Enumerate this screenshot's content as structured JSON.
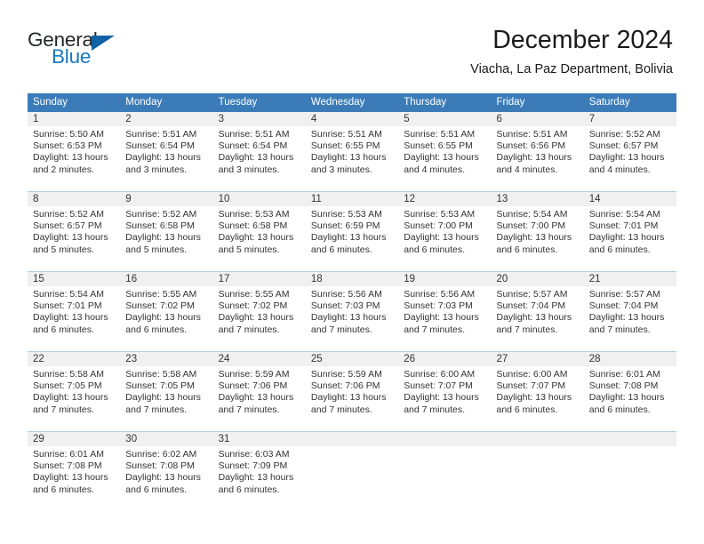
{
  "brand": {
    "name_top": "General",
    "name_bottom": "Blue",
    "accent_color": "#1878be",
    "triangle_color": "#1162a6",
    "logo_icon": "blue-triangle-icon"
  },
  "header": {
    "title": "December 2024",
    "subtitle": "Viacha, La Paz Department, Bolivia"
  },
  "calendar": {
    "header_bg": "#3b7cb8",
    "header_text_color": "#ffffff",
    "daynum_bg": "#f0f0f0",
    "weekday_headers": [
      "Sunday",
      "Monday",
      "Tuesday",
      "Wednesday",
      "Thursday",
      "Friday",
      "Saturday"
    ],
    "weeks": [
      [
        {
          "day": "1",
          "lines": [
            "Sunrise: 5:50 AM",
            "Sunset: 6:53 PM",
            "Daylight: 13 hours",
            "and 2 minutes."
          ]
        },
        {
          "day": "2",
          "lines": [
            "Sunrise: 5:51 AM",
            "Sunset: 6:54 PM",
            "Daylight: 13 hours",
            "and 3 minutes."
          ]
        },
        {
          "day": "3",
          "lines": [
            "Sunrise: 5:51 AM",
            "Sunset: 6:54 PM",
            "Daylight: 13 hours",
            "and 3 minutes."
          ]
        },
        {
          "day": "4",
          "lines": [
            "Sunrise: 5:51 AM",
            "Sunset: 6:55 PM",
            "Daylight: 13 hours",
            "and 3 minutes."
          ]
        },
        {
          "day": "5",
          "lines": [
            "Sunrise: 5:51 AM",
            "Sunset: 6:55 PM",
            "Daylight: 13 hours",
            "and 4 minutes."
          ]
        },
        {
          "day": "6",
          "lines": [
            "Sunrise: 5:51 AM",
            "Sunset: 6:56 PM",
            "Daylight: 13 hours",
            "and 4 minutes."
          ]
        },
        {
          "day": "7",
          "lines": [
            "Sunrise: 5:52 AM",
            "Sunset: 6:57 PM",
            "Daylight: 13 hours",
            "and 4 minutes."
          ]
        }
      ],
      [
        {
          "day": "8",
          "lines": [
            "Sunrise: 5:52 AM",
            "Sunset: 6:57 PM",
            "Daylight: 13 hours",
            "and 5 minutes."
          ]
        },
        {
          "day": "9",
          "lines": [
            "Sunrise: 5:52 AM",
            "Sunset: 6:58 PM",
            "Daylight: 13 hours",
            "and 5 minutes."
          ]
        },
        {
          "day": "10",
          "lines": [
            "Sunrise: 5:53 AM",
            "Sunset: 6:58 PM",
            "Daylight: 13 hours",
            "and 5 minutes."
          ]
        },
        {
          "day": "11",
          "lines": [
            "Sunrise: 5:53 AM",
            "Sunset: 6:59 PM",
            "Daylight: 13 hours",
            "and 6 minutes."
          ]
        },
        {
          "day": "12",
          "lines": [
            "Sunrise: 5:53 AM",
            "Sunset: 7:00 PM",
            "Daylight: 13 hours",
            "and 6 minutes."
          ]
        },
        {
          "day": "13",
          "lines": [
            "Sunrise: 5:54 AM",
            "Sunset: 7:00 PM",
            "Daylight: 13 hours",
            "and 6 minutes."
          ]
        },
        {
          "day": "14",
          "lines": [
            "Sunrise: 5:54 AM",
            "Sunset: 7:01 PM",
            "Daylight: 13 hours",
            "and 6 minutes."
          ]
        }
      ],
      [
        {
          "day": "15",
          "lines": [
            "Sunrise: 5:54 AM",
            "Sunset: 7:01 PM",
            "Daylight: 13 hours",
            "and 6 minutes."
          ]
        },
        {
          "day": "16",
          "lines": [
            "Sunrise: 5:55 AM",
            "Sunset: 7:02 PM",
            "Daylight: 13 hours",
            "and 6 minutes."
          ]
        },
        {
          "day": "17",
          "lines": [
            "Sunrise: 5:55 AM",
            "Sunset: 7:02 PM",
            "Daylight: 13 hours",
            "and 7 minutes."
          ]
        },
        {
          "day": "18",
          "lines": [
            "Sunrise: 5:56 AM",
            "Sunset: 7:03 PM",
            "Daylight: 13 hours",
            "and 7 minutes."
          ]
        },
        {
          "day": "19",
          "lines": [
            "Sunrise: 5:56 AM",
            "Sunset: 7:03 PM",
            "Daylight: 13 hours",
            "and 7 minutes."
          ]
        },
        {
          "day": "20",
          "lines": [
            "Sunrise: 5:57 AM",
            "Sunset: 7:04 PM",
            "Daylight: 13 hours",
            "and 7 minutes."
          ]
        },
        {
          "day": "21",
          "lines": [
            "Sunrise: 5:57 AM",
            "Sunset: 7:04 PM",
            "Daylight: 13 hours",
            "and 7 minutes."
          ]
        }
      ],
      [
        {
          "day": "22",
          "lines": [
            "Sunrise: 5:58 AM",
            "Sunset: 7:05 PM",
            "Daylight: 13 hours",
            "and 7 minutes."
          ]
        },
        {
          "day": "23",
          "lines": [
            "Sunrise: 5:58 AM",
            "Sunset: 7:05 PM",
            "Daylight: 13 hours",
            "and 7 minutes."
          ]
        },
        {
          "day": "24",
          "lines": [
            "Sunrise: 5:59 AM",
            "Sunset: 7:06 PM",
            "Daylight: 13 hours",
            "and 7 minutes."
          ]
        },
        {
          "day": "25",
          "lines": [
            "Sunrise: 5:59 AM",
            "Sunset: 7:06 PM",
            "Daylight: 13 hours",
            "and 7 minutes."
          ]
        },
        {
          "day": "26",
          "lines": [
            "Sunrise: 6:00 AM",
            "Sunset: 7:07 PM",
            "Daylight: 13 hours",
            "and 7 minutes."
          ]
        },
        {
          "day": "27",
          "lines": [
            "Sunrise: 6:00 AM",
            "Sunset: 7:07 PM",
            "Daylight: 13 hours",
            "and 6 minutes."
          ]
        },
        {
          "day": "28",
          "lines": [
            "Sunrise: 6:01 AM",
            "Sunset: 7:08 PM",
            "Daylight: 13 hours",
            "and 6 minutes."
          ]
        }
      ],
      [
        {
          "day": "29",
          "lines": [
            "Sunrise: 6:01 AM",
            "Sunset: 7:08 PM",
            "Daylight: 13 hours",
            "and 6 minutes."
          ]
        },
        {
          "day": "30",
          "lines": [
            "Sunrise: 6:02 AM",
            "Sunset: 7:08 PM",
            "Daylight: 13 hours",
            "and 6 minutes."
          ]
        },
        {
          "day": "31",
          "lines": [
            "Sunrise: 6:03 AM",
            "Sunset: 7:09 PM",
            "Daylight: 13 hours",
            "and 6 minutes."
          ]
        },
        {
          "day": "",
          "lines": []
        },
        {
          "day": "",
          "lines": []
        },
        {
          "day": "",
          "lines": []
        },
        {
          "day": "",
          "lines": []
        }
      ]
    ]
  }
}
